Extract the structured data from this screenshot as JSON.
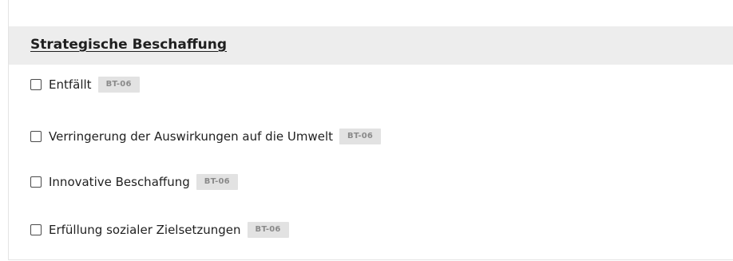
{
  "section": {
    "title": "Strategische Beschaffung"
  },
  "options": [
    {
      "label": "Entfällt",
      "badge": "BT-06",
      "checked": false
    },
    {
      "label": "Verringerung der Auswirkungen auf die Umwelt",
      "badge": "BT-06",
      "checked": false
    },
    {
      "label": "Innovative Beschaffung",
      "badge": "BT-06",
      "checked": false
    },
    {
      "label": "Erfüllung sozialer Zielsetzungen",
      "badge": "BT-06",
      "checked": false
    }
  ]
}
